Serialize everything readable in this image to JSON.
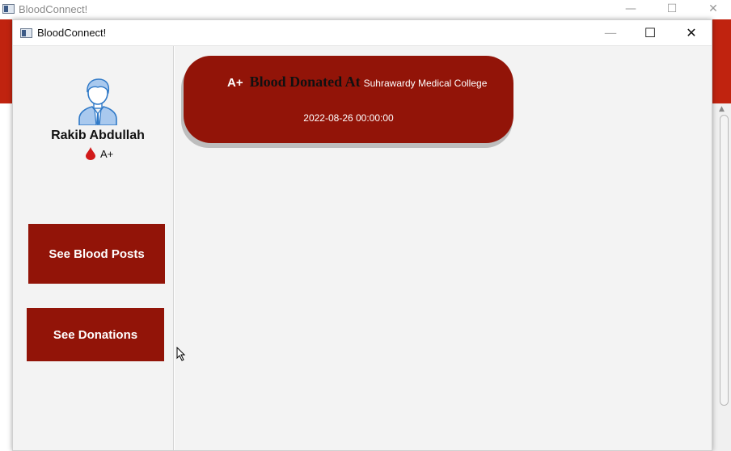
{
  "background_window": {
    "title": "BloodConnect!",
    "controls": {
      "minimize": "—",
      "maximize": "☐",
      "close": "✕"
    }
  },
  "window": {
    "title": "BloodConnect!",
    "controls": {
      "minimize": "—",
      "maximize": "☐",
      "close": "✕"
    }
  },
  "profile": {
    "name": "Rakib Abdullah",
    "blood_type": "A+"
  },
  "sidebar": {
    "see_posts_label": "See Blood Posts",
    "see_donations_label": "See Donations"
  },
  "donation_card": {
    "blood_type": "A+",
    "heading": "Blood Donated At",
    "place": "Suhrawardy Medical College",
    "datetime": "2022-08-26 00:00:00"
  },
  "colors": {
    "accent": "#921408",
    "header_red": "#c0230f",
    "panel_bg": "#f3f3f3"
  }
}
